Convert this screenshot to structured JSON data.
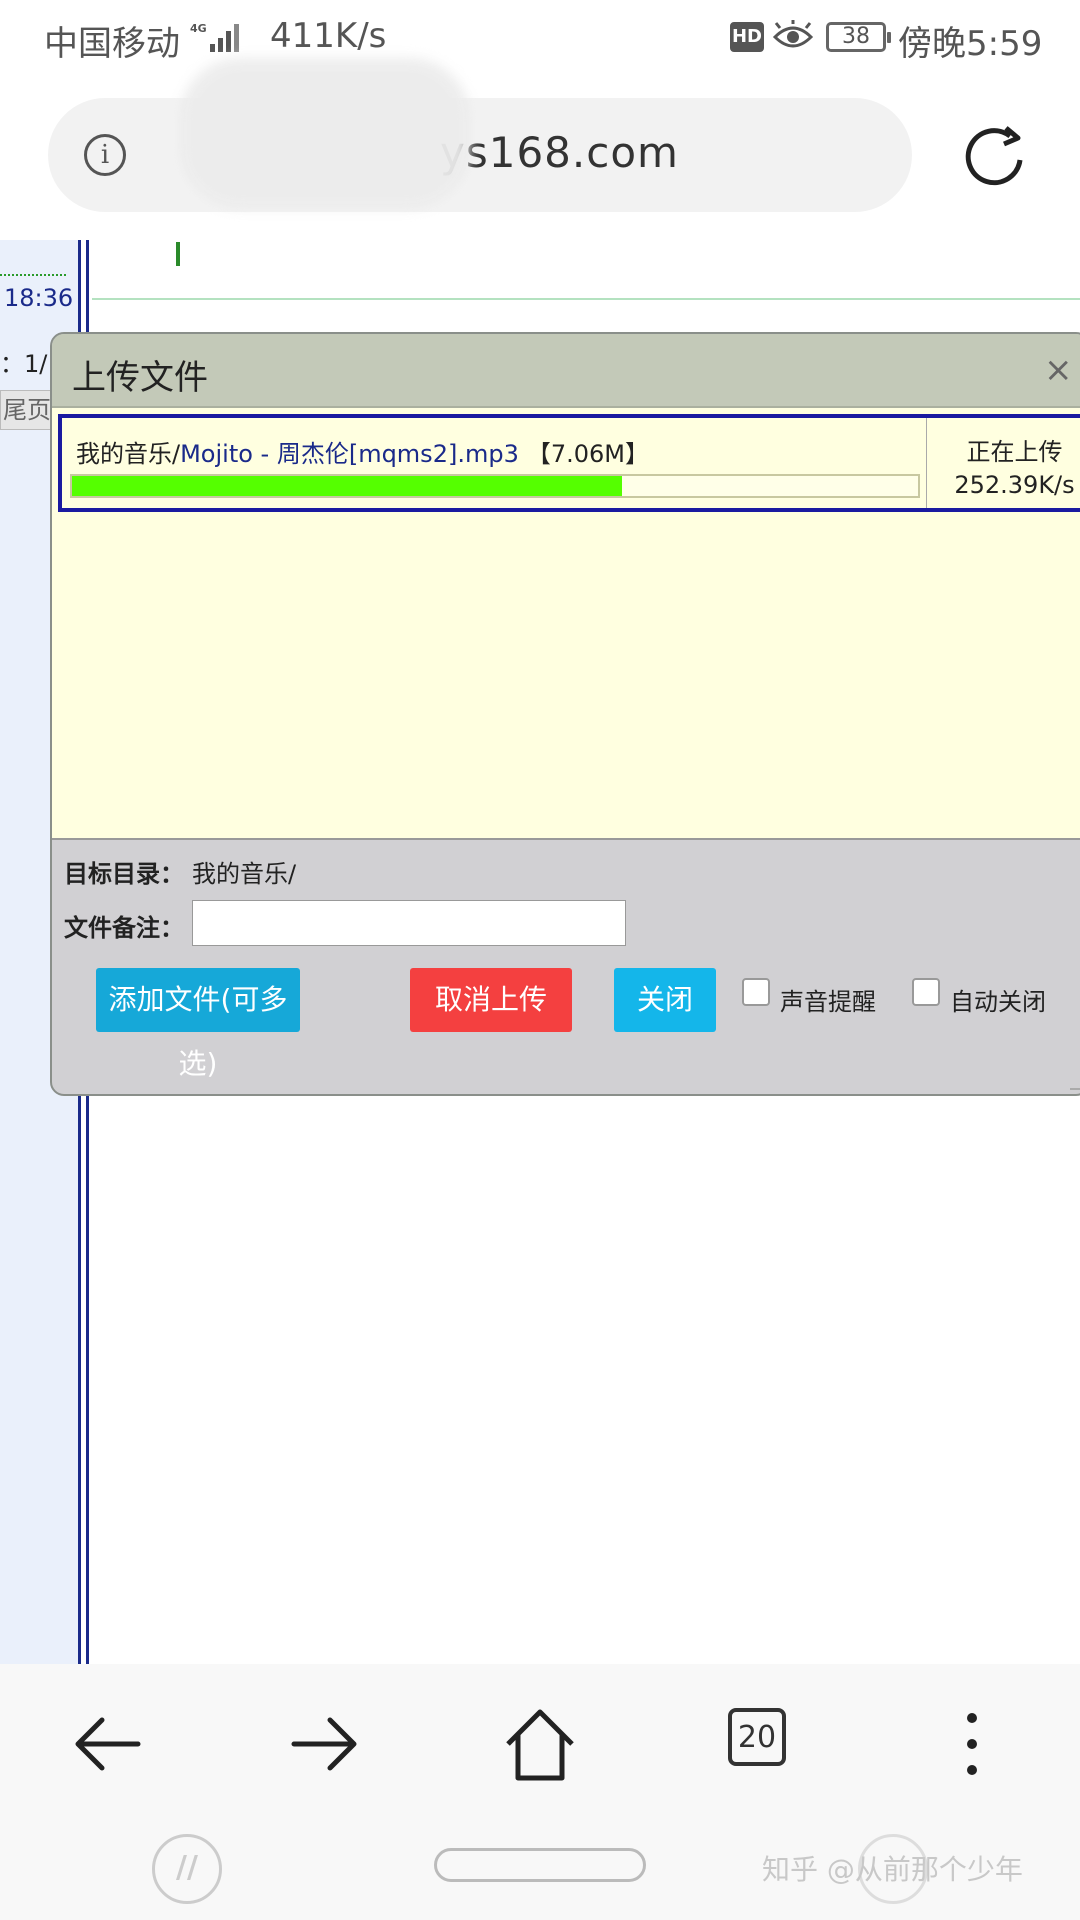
{
  "status_bar": {
    "carrier": "中国移动",
    "network": "4G",
    "speed": "411K/s",
    "hd": "HD",
    "battery": "38",
    "time": "傍晚5:59"
  },
  "address_bar": {
    "url": "ys168.com"
  },
  "background_page": {
    "time": "18:36",
    "page_indicator": "：1/",
    "last_page": "尾页"
  },
  "upload_dialog": {
    "title": "上传文件",
    "close_symbol": "×",
    "file": {
      "directory": "我的音乐/",
      "name": "Mojito - 周杰伦[mqms2].mp3",
      "size": "【7.06M】",
      "progress_percent": 65,
      "status": "正在上传",
      "rate": "252.39K/s"
    },
    "target_dir_label": "目标目录：",
    "target_dir_value": "我的音乐/",
    "note_label": "文件备注：",
    "note_value": "",
    "buttons": {
      "add": "添加文件(可多选)",
      "cancel": "取消上传",
      "close": "关闭"
    },
    "options": {
      "sound_alert": "声音提醒",
      "auto_close": "自动关闭"
    }
  },
  "toolbar": {
    "tab_count": "20"
  },
  "watermark": "知乎 @从前那个少年"
}
